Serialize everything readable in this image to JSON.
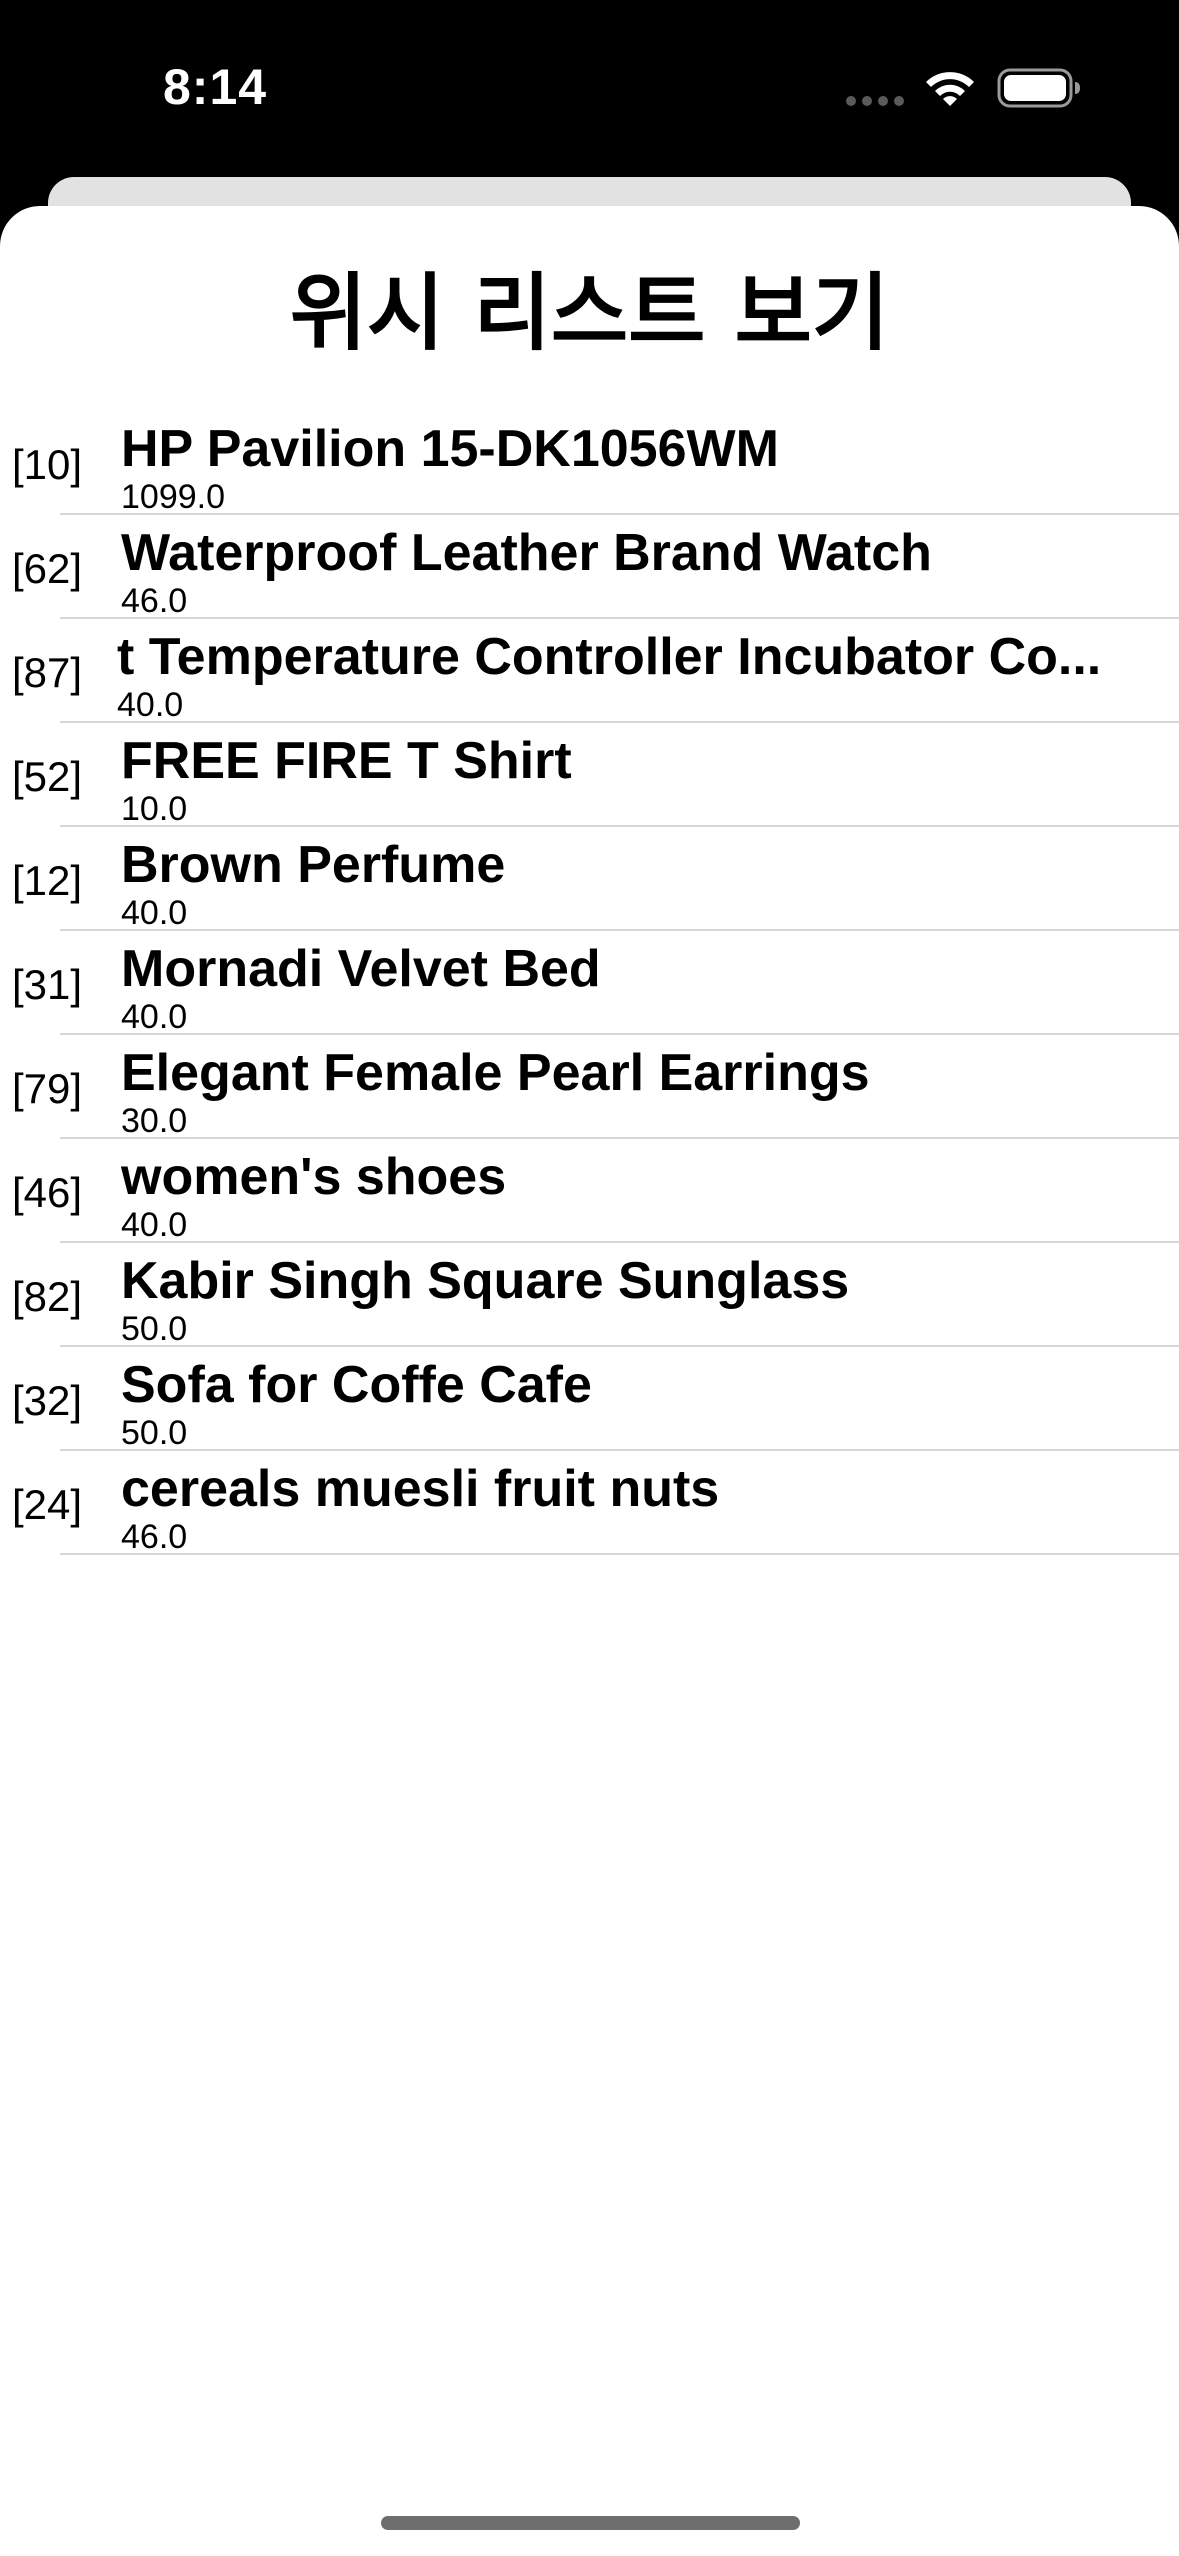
{
  "status_bar": {
    "time": "8:14",
    "icons": [
      "signal-dots-icon",
      "wifi-icon",
      "battery-icon"
    ]
  },
  "sheet": {
    "title": "위시 리스트 보기"
  },
  "wishlist": {
    "items": [
      {
        "index": "[10]",
        "name": "HP Pavilion 15-DK1056WM",
        "price": "1099.0"
      },
      {
        "index": "[62]",
        "name": "Waterproof Leather Brand Watch",
        "price": "46.0"
      },
      {
        "index": "[87]",
        "name": "t Temperature Controller Incubator Co...",
        "price": "40.0"
      },
      {
        "index": "[52]",
        "name": "FREE FIRE T Shirt",
        "price": "10.0"
      },
      {
        "index": "[12]",
        "name": "Brown Perfume",
        "price": "40.0"
      },
      {
        "index": "[31]",
        "name": "Mornadi Velvet Bed",
        "price": "40.0"
      },
      {
        "index": "[79]",
        "name": "Elegant Female Pearl Earrings",
        "price": "30.0"
      },
      {
        "index": "[46]",
        "name": "women's shoes",
        "price": "40.0"
      },
      {
        "index": "[82]",
        "name": "Kabir Singh Square Sunglass",
        "price": "50.0"
      },
      {
        "index": "[32]",
        "name": "Sofa for Coffe Cafe",
        "price": "50.0"
      },
      {
        "index": "[24]",
        "name": "cereals muesli fruit nuts",
        "price": "46.0"
      }
    ]
  },
  "colors": {
    "status_bar_bg": "#000000",
    "sheet_bg": "#ffffff",
    "back_sheet_bg": "#e2e2e2",
    "divider": "#d6d6d6",
    "text": "#000000"
  }
}
